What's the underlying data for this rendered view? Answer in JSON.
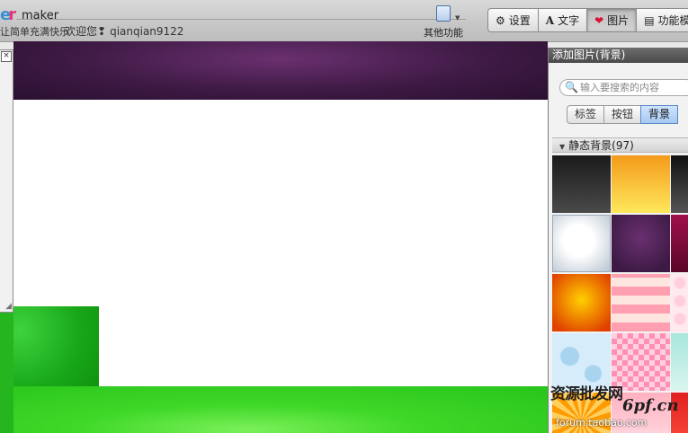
{
  "header": {
    "logo_word": "maker",
    "slogan": "让简单充满快乐",
    "welcome_text": "欢迎您",
    "username": "qianqian9122",
    "other_functions_label": "其他功能"
  },
  "main_tabs": [
    {
      "label": "设置",
      "icon": "gear-icon",
      "active": false
    },
    {
      "label": "文字",
      "icon": "text-icon",
      "active": false
    },
    {
      "label": "图片",
      "icon": "heart-icon",
      "active": true
    },
    {
      "label": "功能模",
      "icon": "module-icon",
      "active": false
    }
  ],
  "left_panel": {
    "close_icon": "close-icon"
  },
  "right_panel": {
    "title": "添加图片(背景)",
    "search_placeholder": "输入要搜索的内容",
    "categories": [
      {
        "label": "标签",
        "active": false
      },
      {
        "label": "按钮",
        "active": false
      },
      {
        "label": "背景",
        "active": true
      }
    ],
    "section_title": "静态背景(97)",
    "thumbnails": [
      {
        "name": "dark-gradient",
        "colors": [
          "#1a1a1a",
          "#4a4a4a"
        ]
      },
      {
        "name": "orange-yellow",
        "colors": [
          "#f39a1a",
          "#ffe85c"
        ]
      },
      {
        "name": "dark-stripe",
        "colors": [
          "#111111",
          "#555555"
        ]
      },
      {
        "name": "white-glow",
        "colors": [
          "#ffffff",
          "#b7c4d0"
        ]
      },
      {
        "name": "purple-glow",
        "colors": [
          "#6a3070",
          "#3c1a44"
        ]
      },
      {
        "name": "magenta",
        "colors": [
          "#a0104c",
          "#5a0628"
        ]
      },
      {
        "name": "orange-sun",
        "colors": [
          "#ffd000",
          "#e04000"
        ]
      },
      {
        "name": "pink-plaid",
        "colors": [
          "#ff9fb0",
          "#ffe5e0"
        ]
      },
      {
        "name": "pink-dots",
        "colors": [
          "#ffd0dc",
          "#ffe8ee"
        ]
      },
      {
        "name": "blue-hearts",
        "colors": [
          "#d6ecfa",
          "#a8d4f0"
        ]
      },
      {
        "name": "pink-checker",
        "colors": [
          "#ff8fb3",
          "#ffd0e0"
        ]
      },
      {
        "name": "aqua-waves",
        "colors": [
          "#a8e6dc",
          "#d9f5ef"
        ]
      },
      {
        "name": "orange-burst",
        "colors": [
          "#ff9a00",
          "#ffd060"
        ]
      },
      {
        "name": "pink-pattern",
        "colors": [
          "#ffb0c0",
          "#ffe0e6"
        ]
      },
      {
        "name": "red",
        "colors": [
          "#e02020",
          "#ff5040"
        ]
      }
    ]
  },
  "watermark": {
    "line1": "资源批发网",
    "line2": "6pf.cn",
    "line3": "forum.taobao.com"
  }
}
